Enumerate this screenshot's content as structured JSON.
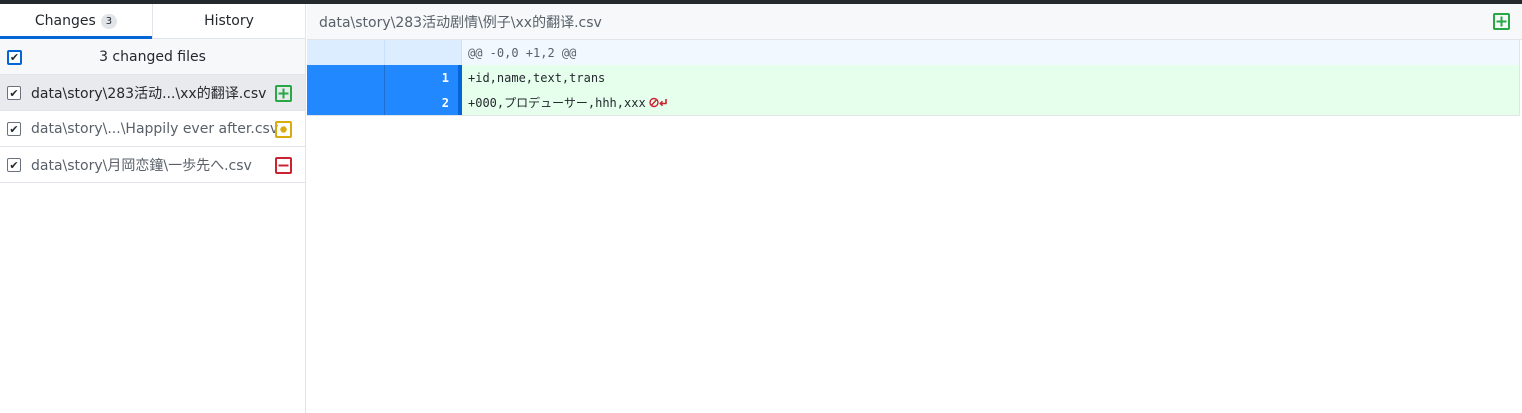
{
  "tabs": {
    "changes_label": "Changes",
    "changes_count": "3",
    "history_label": "History"
  },
  "changes": {
    "summary": "3 changed files",
    "files": [
      {
        "path": "data\\story\\283活动...\\xx的翻译.csv",
        "status": "added",
        "selected": true
      },
      {
        "path": "data\\story\\...\\Happily ever after.csv",
        "status": "modified",
        "selected": false
      },
      {
        "path": "data\\story\\月岡恋鐘\\一歩先へ.csv",
        "status": "deleted",
        "selected": false
      }
    ]
  },
  "diff": {
    "file_path": "data\\story\\283活动剧情\\例子\\xx的翻译.csv",
    "hunk_header": "@@ -0,0 +1,2 @@",
    "lines": [
      {
        "old": "",
        "new": "1",
        "text": "+id,name,text,trans",
        "no_newline": false
      },
      {
        "old": "",
        "new": "2",
        "text": "+000,プロデューサー,hhh,xxx",
        "no_newline": true
      }
    ]
  },
  "colors": {
    "accent": "#0366d6",
    "added": "#28a745",
    "modified": "#dbab09",
    "deleted": "#cb2431",
    "added_bg": "#e6ffed",
    "selected_gutter": "#2188ff"
  }
}
